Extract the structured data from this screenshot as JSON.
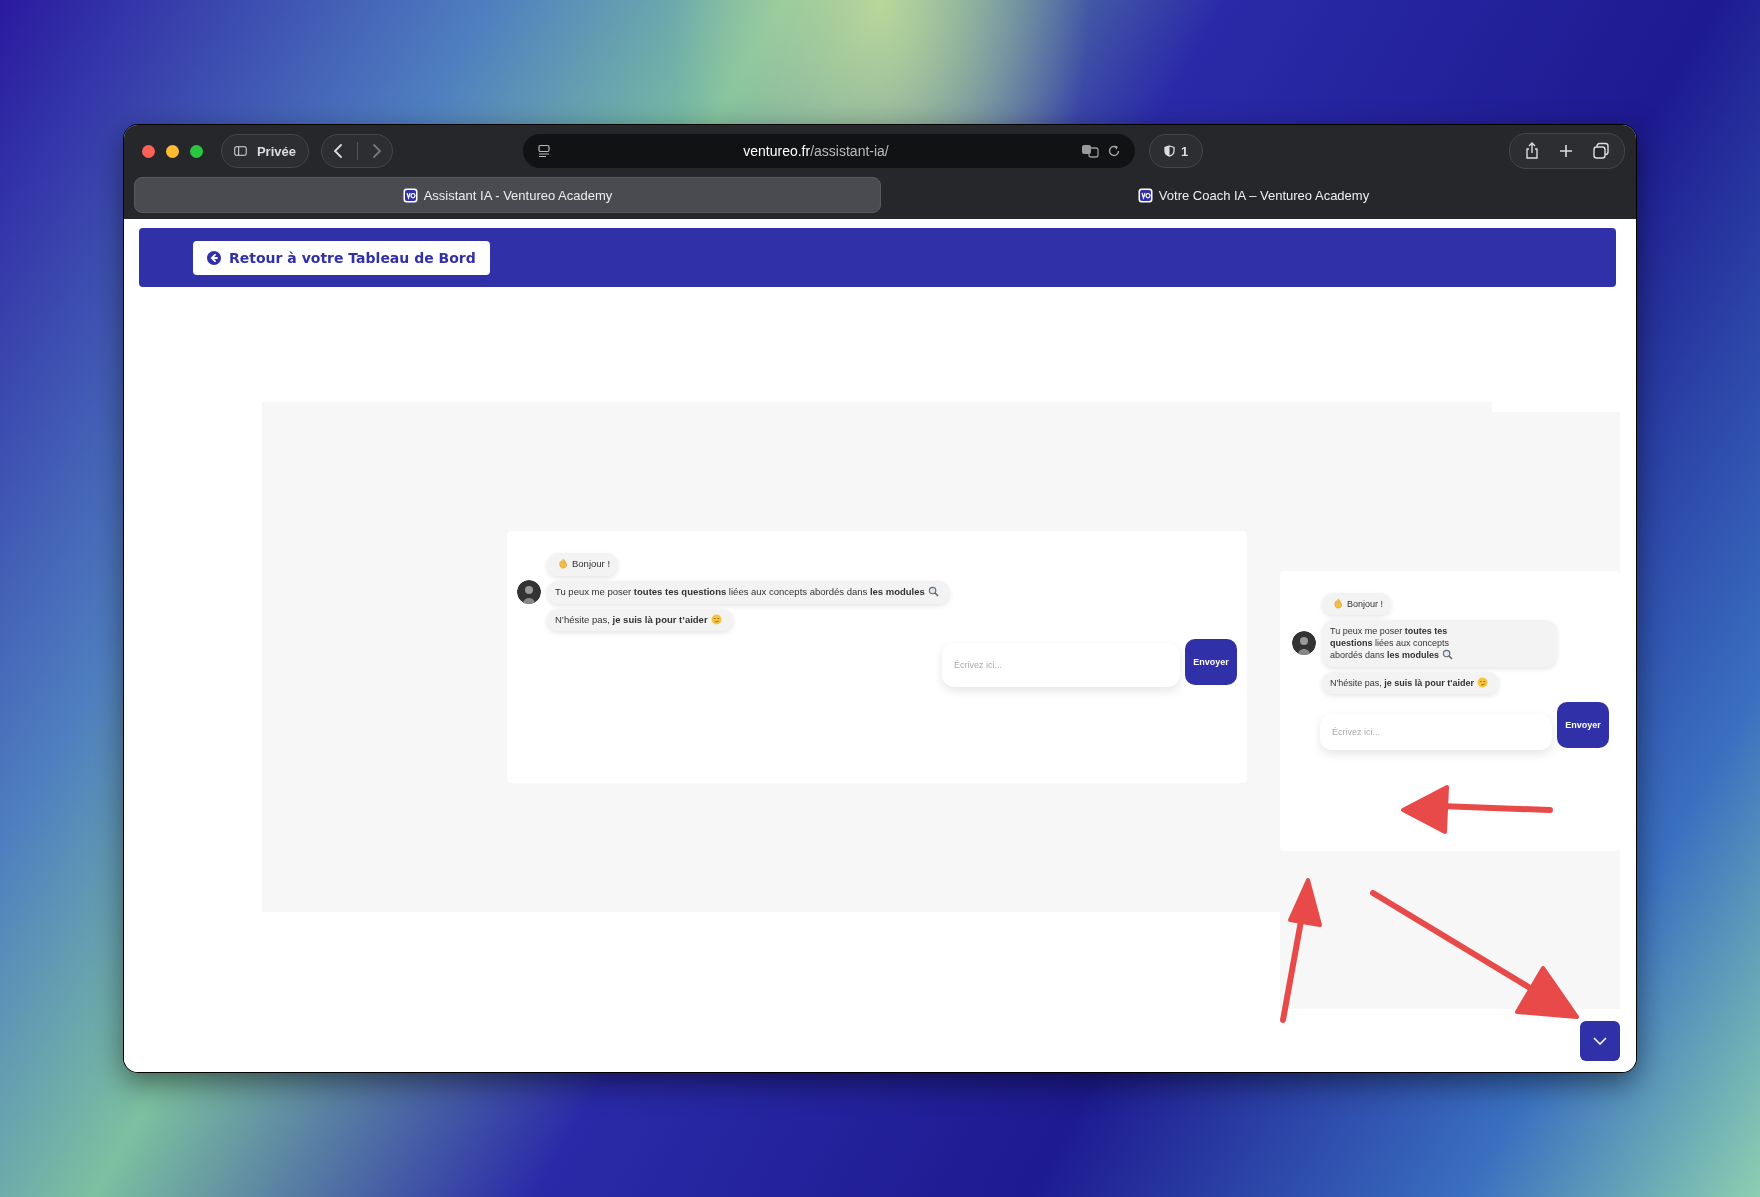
{
  "browser": {
    "private_label": "Privée",
    "address": {
      "domain": "ventureo.fr",
      "path": "/assistant-ia/"
    },
    "shields_count": "1",
    "tabs": [
      {
        "title": "Assistant IA - Ventureo Academy",
        "selected": true
      },
      {
        "title": "Votre Coach IA – Ventureo Academy",
        "selected": false
      }
    ]
  },
  "header": {
    "back_button": "Retour à votre Tableau de Bord"
  },
  "chat_widgets": [
    {
      "kind": "wide",
      "messages": [
        {
          "text": "Bonjour !",
          "kind": "wave"
        },
        {
          "text": "Tu peux me poser **toutes tes questions** liées aux concepts abordés dans **les modules**",
          "kind": "magnifier"
        },
        {
          "text": "N’hésite pas, **je suis là pour t’aider**",
          "kind": "smirk"
        }
      ],
      "placeholder": "Écrivez ici...",
      "send_button": "Envoyer"
    },
    {
      "kind": "narrow",
      "messages": [
        {
          "text": "Bonjour !",
          "kind": "wave"
        },
        {
          "text": "Tu peux me poser **toutes tes questions** liées aux concepts abordés dans **les modules**",
          "kind": "magnifier"
        },
        {
          "text": "N'hésite pas, **je suis là pour t'aider**",
          "kind": "smirk"
        }
      ],
      "placeholder": "Écrivez ici...",
      "send_button": "Envoyer"
    }
  ]
}
